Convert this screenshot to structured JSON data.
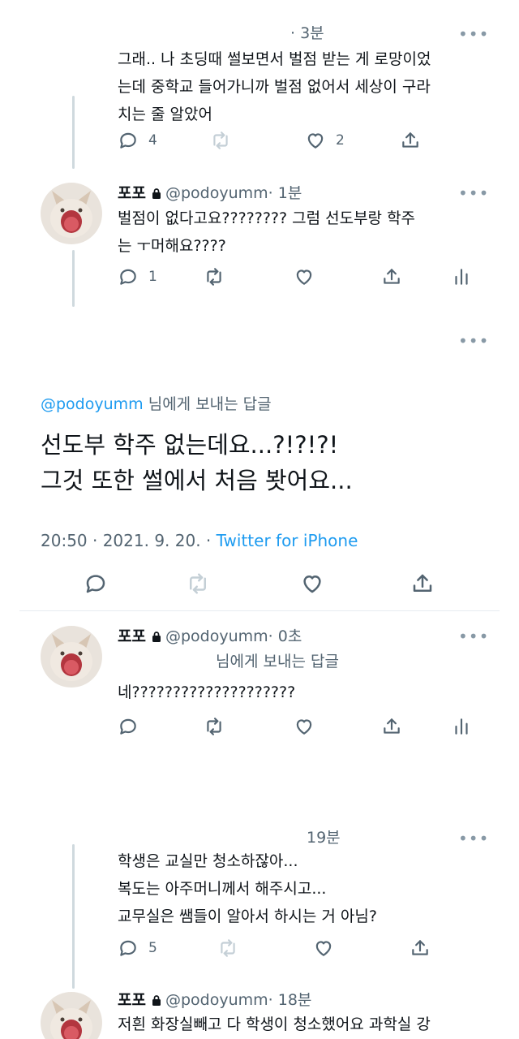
{
  "tweet1": {
    "time": "· 3분",
    "text": "그래.. 나 초딩때 썰보면서 벌점 받는 게 로망이었\n는데 중학교 들어가니까 벌점 없어서 세상이 구라\n치는 줄 알았어",
    "reply_count": "4",
    "like_count": "2"
  },
  "tweet2": {
    "name": "포포",
    "handle": "@podoyumm",
    "time": "· 1분",
    "text": "벌점이 없다고요???????? 그럼 선도부랑 학주\n는 ㅜ머해요????",
    "reply_count": "1"
  },
  "main_tweet": {
    "reply_to_handle": "@podoyumm",
    "reply_to_suffix": " 님에게 보내는 답글",
    "text": "선도부 학주 없는데요...?!?!?!\n그것 또한 썰에서 처음 봣어요...",
    "timestamp": "20:50 · 2021. 9. 20. · ",
    "source": "Twitter for iPhone"
  },
  "tweet3": {
    "name": "포포",
    "handle": "@podoyumm",
    "time": "· 0초",
    "reply_label": "님에게 보내는 답글",
    "text": "네????????????????????"
  },
  "tweet4": {
    "time": "19분",
    "text": "학생은 교실만 청소하잖아...\n복도는 아주머니께서 해주시고...\n교무실은 쌤들이 알아서 하시는 거 아님?",
    "reply_count": "5"
  },
  "tweet5": {
    "name": "포포",
    "handle": "@podoyumm",
    "time": "· 18분",
    "text": "저흰 화장실빼고 다 학생이 청소했어요 과학실 강"
  },
  "ui": {
    "more_dots": "•••",
    "accent_color": "#1d9bf0",
    "icons": [
      "reply-icon",
      "retweet-icon",
      "like-icon",
      "share-icon",
      "analytics-icon",
      "lock-icon"
    ]
  }
}
